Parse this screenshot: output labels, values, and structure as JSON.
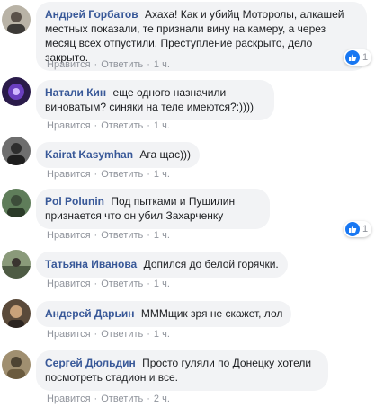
{
  "action_like": "Нравится",
  "action_reply": "Ответить",
  "separator": "·",
  "comments": [
    {
      "author": "Андрей Горбатов",
      "text": "Ахаха! Как и убийц Моторолы, алкашей местных показали, те признали вину на камеру, а через месяц всех отпустили. Преступление раскрыто, дело закрыто.",
      "time": "1 ч.",
      "reactions": "1"
    },
    {
      "author": "Натали Кин",
      "text": "еще одного назначили виноватым? синяки на теле имеются?:))))",
      "time": "1 ч."
    },
    {
      "author": "Kairat Kasymhan",
      "text": "Ага щас)))",
      "time": "1 ч."
    },
    {
      "author": "Pol Polunin",
      "text": "Под пытками и Пушилин признается что он убил Захарченку",
      "time": "1 ч.",
      "reactions": "1"
    },
    {
      "author": "Татьяна Иванова",
      "text": "Допился до белой горячки.",
      "time": "1 ч."
    },
    {
      "author": "Андерей Дарьин",
      "text": "МММщик зря не скажет, лол",
      "time": "1 ч."
    },
    {
      "author": "Сергей Дюльдин",
      "text": "Просто гуляли по Донецку хотели посмотреть стадион и все.",
      "time": "2 ч."
    }
  ]
}
